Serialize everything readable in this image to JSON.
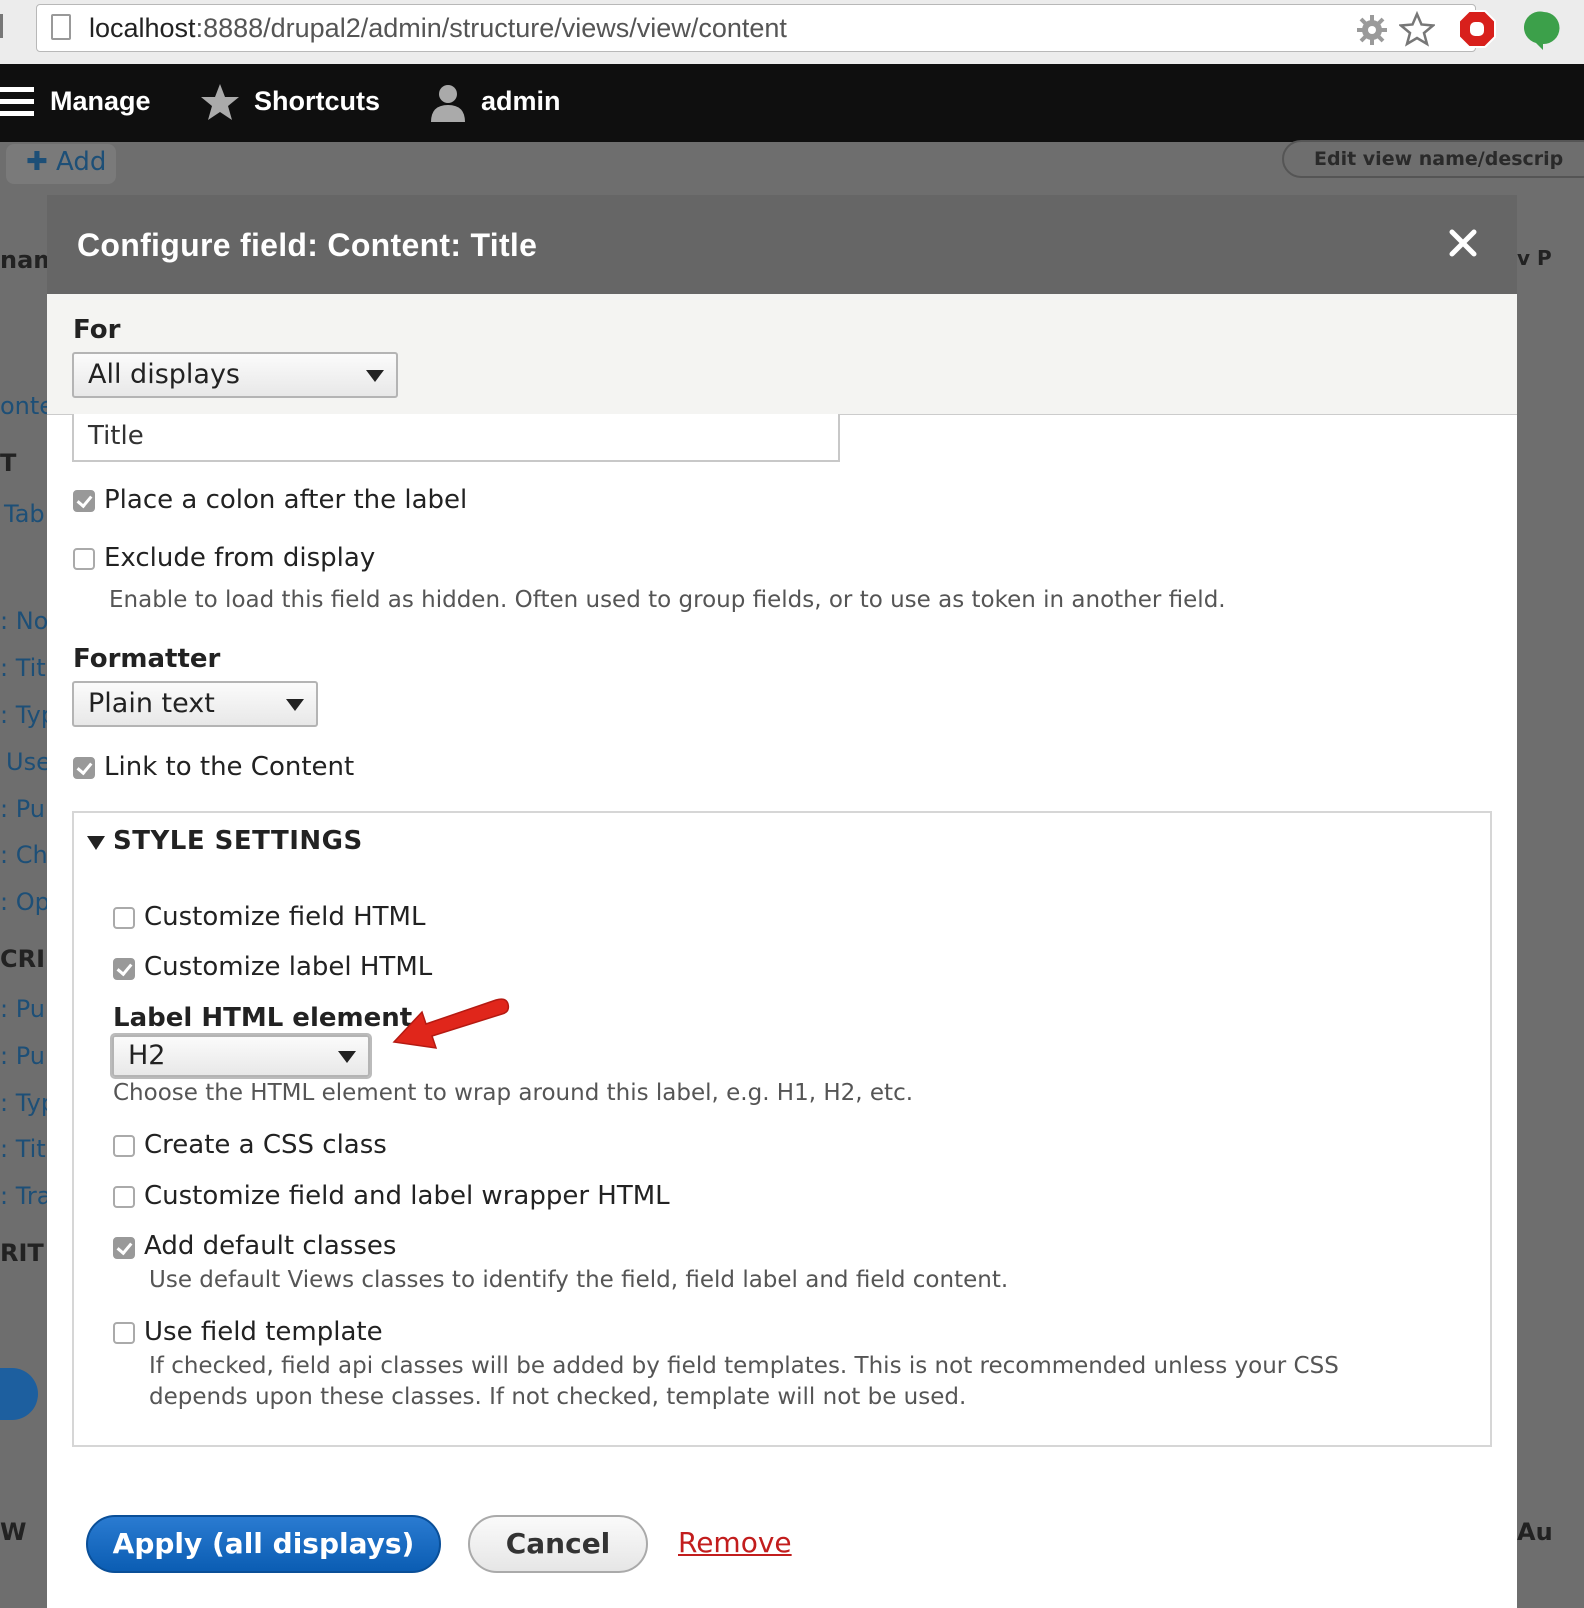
{
  "browser": {
    "url_host": "localhost",
    "url_rest": ":8888/drupal2/admin/structure/views/view/content"
  },
  "toolbar": {
    "manage_label": "Manage",
    "shortcuts_label": "Shortcuts",
    "user_label": "admin"
  },
  "background": {
    "add_label": "✚ Add",
    "edit_view_label": "Edit view name/descrip",
    "fragments": [
      "nam",
      "onter",
      "T",
      "Tab",
      ": No",
      ": Titl",
      ": Typ",
      "Use",
      ": Pul",
      ": Cha",
      ": Op",
      "CRI",
      ": Pul",
      ": Pul",
      ": Typ",
      ": Titl",
      ": Tra",
      "RIT",
      "W"
    ],
    "right_fragments": [
      "v P",
      "Au"
    ]
  },
  "dialog": {
    "title": "Configure field: Content: Title",
    "for_label": "For",
    "for_value": "All displays",
    "label_value": "Title",
    "colon_label": "Place a colon after the label",
    "colon_checked": true,
    "exclude_label": "Exclude from display",
    "exclude_checked": false,
    "exclude_desc": "Enable to load this field as hidden. Often used to group fields, or to use as token in another field.",
    "formatter_label": "Formatter",
    "formatter_value": "Plain text",
    "link_label": "Link to the Content",
    "link_checked": true,
    "style": {
      "legend": "STYLE SETTINGS",
      "customize_field_html": "Customize field HTML",
      "customize_label_html": "Customize label HTML",
      "label_element_label": "Label HTML element",
      "label_element_value": "H2",
      "label_element_desc": "Choose the HTML element to wrap around this label, e.g. H1, H2, etc.",
      "create_css_class": "Create a CSS class",
      "customize_wrapper": "Customize field and label wrapper HTML",
      "add_default_classes": "Add default classes",
      "add_default_desc": "Use default Views classes to identify the field, field label and field content.",
      "use_field_template": "Use field template",
      "use_field_template_desc_1": "If checked, field api classes will be added by field templates. This is not recommended unless your CSS",
      "use_field_template_desc_2": "depends upon these classes. If not checked, template will not be used."
    },
    "buttons": {
      "apply": "Apply (all displays)",
      "cancel": "Cancel",
      "remove": "Remove"
    }
  },
  "colors": {
    "toolbar_bg": "#0f0f0f",
    "dialog_header": "#666666",
    "primary_button": "#0b5db3",
    "remove_link": "#c21d1d",
    "annotation_arrow": "#e0261b"
  }
}
